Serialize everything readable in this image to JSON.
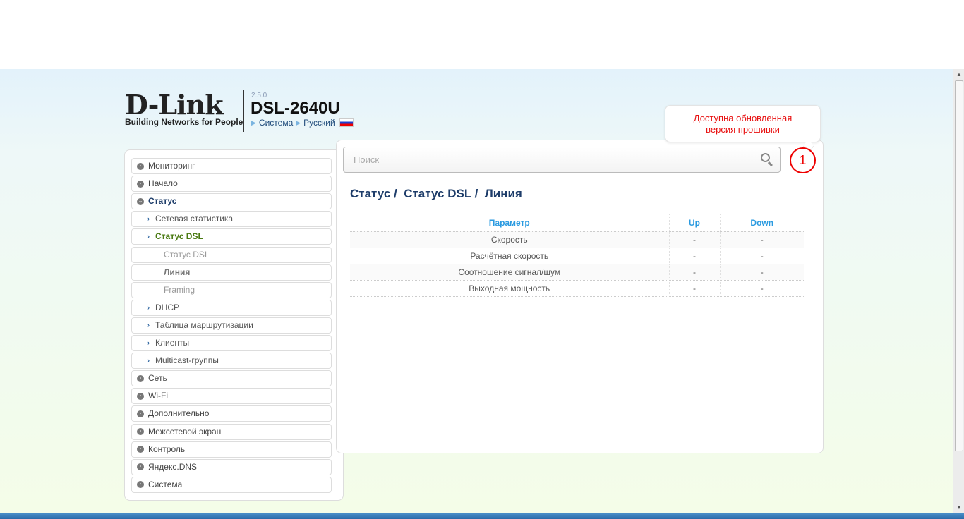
{
  "header": {
    "logo": "D-Link",
    "logo_tagline": "Building Networks for People",
    "version": "2.5.0",
    "model": "DSL-2640U",
    "links": [
      "Система",
      "Русский"
    ]
  },
  "search": {
    "placeholder": "Поиск"
  },
  "notification": {
    "count": "1",
    "tooltip_line1": "Доступна обновленная",
    "tooltip_line2": "версия прошивки",
    "color": "#e81010"
  },
  "sidebar": {
    "items": [
      {
        "label": "Мониторинг"
      },
      {
        "label": "Начало"
      },
      {
        "label": "Статус"
      },
      {
        "label": "Сетевая статистика"
      },
      {
        "label": "Статус DSL"
      },
      {
        "label": "Статус DSL"
      },
      {
        "label": "Линия"
      },
      {
        "label": "Framing"
      },
      {
        "label": "DHCP"
      },
      {
        "label": "Таблица маршрутизации"
      },
      {
        "label": "Клиенты"
      },
      {
        "label": "Multicast-группы"
      },
      {
        "label": "Сеть"
      },
      {
        "label": "Wi-Fi"
      },
      {
        "label": "Дополнительно"
      },
      {
        "label": "Межсетевой экран"
      },
      {
        "label": "Контроль"
      },
      {
        "label": "Яндекс.DNS"
      },
      {
        "label": "Система"
      }
    ]
  },
  "breadcrumb": [
    "Статус /",
    "Статус DSL /",
    "Линия"
  ],
  "table": {
    "headers": [
      "Параметр",
      "Up",
      "Down"
    ],
    "rows": [
      [
        "Скорость",
        "-",
        "-"
      ],
      [
        "Расчётная скорость",
        "-",
        "-"
      ],
      [
        "Соотношение сигнал/шум",
        "-",
        "-"
      ],
      [
        "Выходная мощность",
        "-",
        "-"
      ]
    ]
  }
}
